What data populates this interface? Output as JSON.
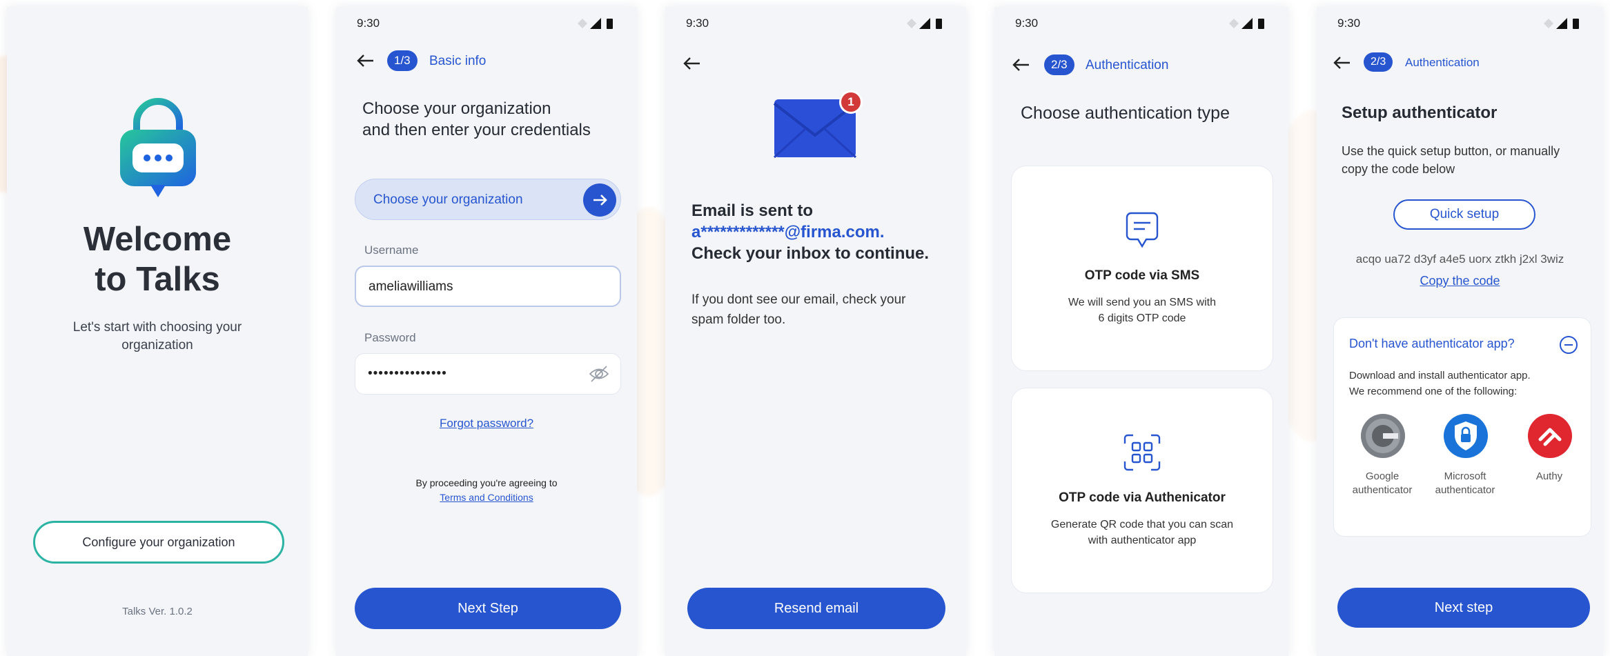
{
  "status_bar": {
    "time": "9:30"
  },
  "screen1": {
    "title_line1": "Welcome",
    "title_line2": "to Talks",
    "subtitle_line1": "Let's start with choosing your",
    "subtitle_line2": "organization",
    "configure_button": "Configure your organization",
    "version": "Talks Ver. 1.0.2"
  },
  "screen2": {
    "step": "1/3",
    "step_label": "Basic info",
    "heading_line1": "Choose your organization",
    "heading_line2": "and then enter your credentials",
    "org_field": "Choose your organization",
    "username_label": "Username",
    "username_value": "ameliawilliams",
    "password_label": "Password",
    "password_value": "•••••••••••••••",
    "forgot": "Forgot password?",
    "agree_text": "By proceeding you're agreeing to",
    "terms": "Terms and Conditions",
    "next": "Next Step"
  },
  "screen3": {
    "badge_count": "1",
    "line1": "Email is sent to",
    "email": "a*************@firma.com.",
    "line3": "Check your inbox to continue.",
    "note_line1": "If you dont see our email, check your",
    "note_line2": "spam folder too.",
    "resend": "Resend email"
  },
  "screen4": {
    "step": "2/3",
    "step_label": "Authentication",
    "heading": "Choose authentication type",
    "sms_title": "OTP code via SMS",
    "sms_desc_line1": "We will send you an SMS with",
    "sms_desc_line2": "6 digits OTP code",
    "auth_title": "OTP code via Authenicator",
    "auth_desc_line1": "Generate QR code that you can scan",
    "auth_desc_line2": "with authenticator app"
  },
  "screen5": {
    "step": "2/3",
    "step_label": "Authentication",
    "heading": "Setup authenticator",
    "desc_line1": "Use the quick setup button, or manually",
    "desc_line2": "copy the code below",
    "quick_setup": "Quick setup",
    "code": "acqo ua72 d3yf a4e5 uorx ztkh j2xl 3wiz",
    "copy": "Copy the code",
    "no_app_title": "Don't have authenticator app?",
    "no_app_desc_line1": "Download and install authenticator app.",
    "no_app_desc_line2": "We recommend one of the following:",
    "apps": [
      {
        "line1": "Google",
        "line2": "authenticator"
      },
      {
        "line1": "Microsoft",
        "line2": "authenticator"
      },
      {
        "line1": "Authy",
        "line2": ""
      }
    ],
    "next": "Next step"
  },
  "colors": {
    "accent": "#2755d0",
    "background": "#f3f5f9",
    "teal": "#2bb3a3",
    "authy_red": "#e0262f"
  }
}
